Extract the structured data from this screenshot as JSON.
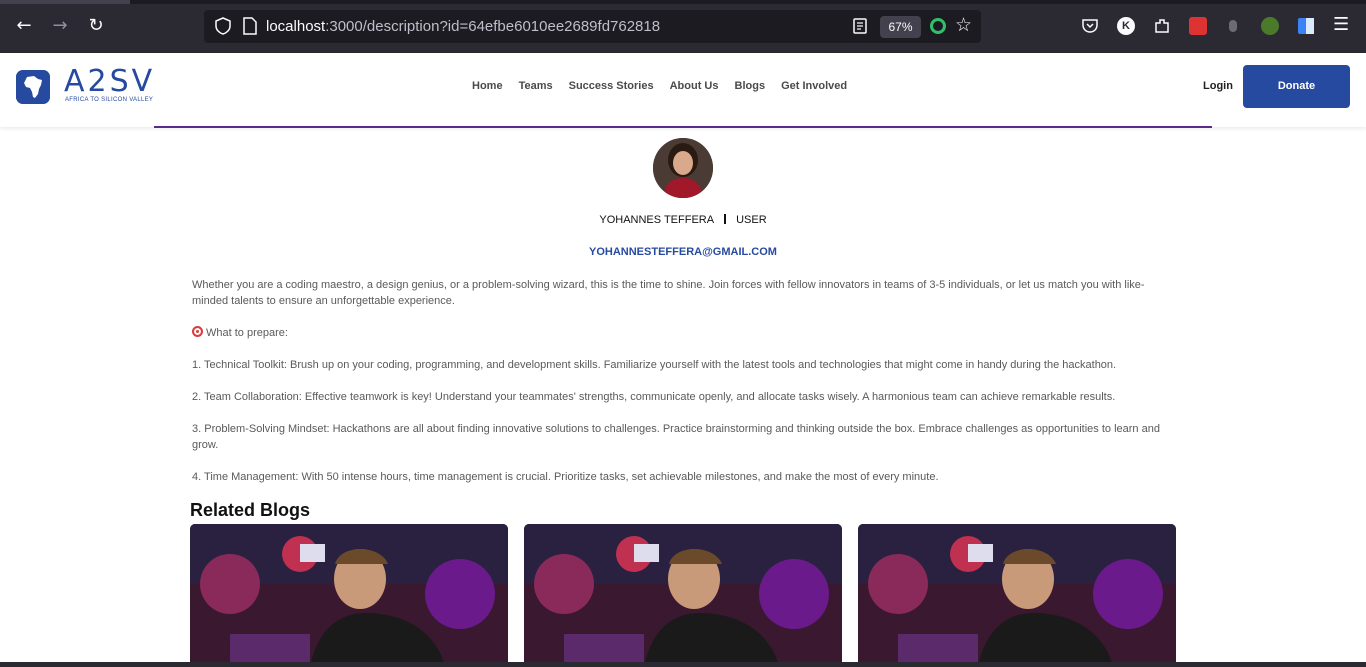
{
  "browser": {
    "url_host": "localhost",
    "url_rest": ":3000/description?id=64efbe6010ee2689fd762818",
    "zoom": "67%",
    "profile_initial": "K"
  },
  "header": {
    "logo_text": "A2SV",
    "logo_subtitle": "AFRICA TO SILICON VALLEY",
    "nav": [
      "Home",
      "Teams",
      "Success Stories",
      "About Us",
      "Blogs",
      "Get Involved"
    ],
    "login_label": "Login",
    "donate_label": "Donate"
  },
  "author": {
    "name": "YOHANNES TEFFERA",
    "role": "USER",
    "email": "YOHANNESTEFFERA@GMAIL.COM"
  },
  "content": {
    "intro": " Whether you are a coding maestro, a design genius, or a problem-solving wizard, this is the time to shine. Join forces with fellow innovators in teams of 3-5 individuals, or let us match you with like-minded talents to ensure an unforgettable experience.",
    "prepare_heading": "What to prepare:",
    "items": [
      "1. Technical Toolkit: Brush up on your coding, programming, and development skills. Familiarize yourself with the latest tools and technologies that might come in handy during the hackathon.",
      "2. Team Collaboration: Effective teamwork is key! Understand your teammates' strengths, communicate openly, and allocate tasks wisely. A harmonious team can achieve remarkable results.",
      "3. Problem-Solving Mindset: Hackathons are all about finding innovative solutions to challenges. Practice brainstorming and thinking outside the box. Embrace challenges as opportunities to learn and grow.",
      "4. Time Management: With 50 intense hours, time management is crucial. Prioritize tasks, set achievable milestones, and make the most of every minute."
    ]
  },
  "related": {
    "title": "Related Blogs",
    "cards": 3
  }
}
